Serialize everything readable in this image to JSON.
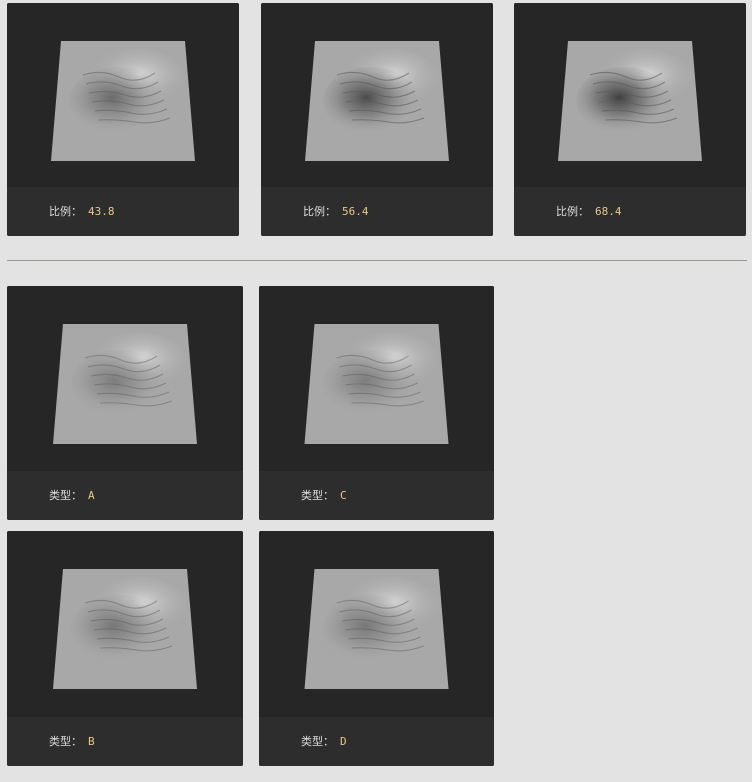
{
  "sections": {
    "ratio": {
      "items": [
        {
          "label": "比例：",
          "value": "43.8",
          "shade": 0.55
        },
        {
          "label": "比例：",
          "value": "56.4",
          "shade": 0.85
        },
        {
          "label": "比例：",
          "value": "68.4",
          "shade": 0.95
        }
      ]
    },
    "type": {
      "items": [
        {
          "label": "类型：",
          "value": "A",
          "shade": 0.4
        },
        {
          "label": "类型：",
          "value": "C",
          "shade": 0.4
        },
        {
          "label": "类型：",
          "value": "B",
          "shade": 0.45
        },
        {
          "label": "类型：",
          "value": "D",
          "shade": 0.45
        }
      ]
    }
  },
  "colors": {
    "page_bg": "#e3e3e3",
    "card_bg": "#262626",
    "caption_bg": "#2d2d2d",
    "label": "#dddddd",
    "value": "#e8c98a",
    "terrain": "#a8a8a8",
    "divider": "#9a958e"
  }
}
